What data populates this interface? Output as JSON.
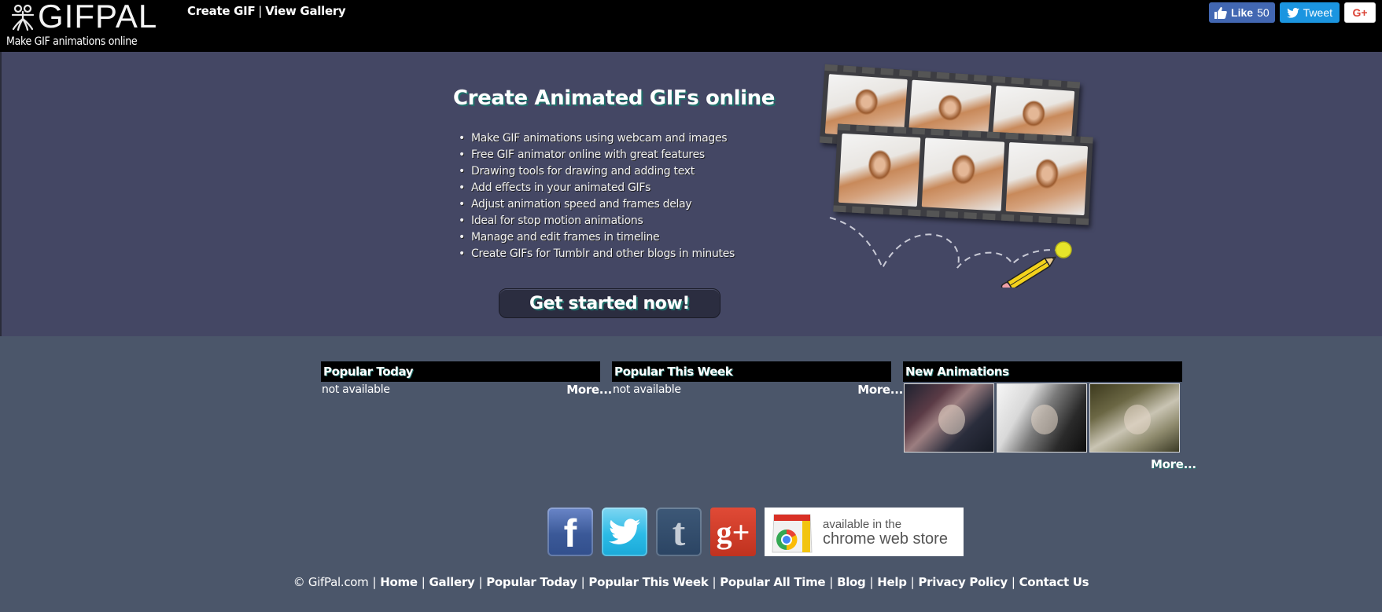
{
  "header": {
    "logo_text": "GIFPAL",
    "tagline": "Make GIF animations online",
    "nav": [
      {
        "label": "Create GIF"
      },
      {
        "label": "View Gallery"
      }
    ],
    "nav_separator": "|",
    "social": {
      "like_label": "Like",
      "like_count": "50",
      "tweet_label": "Tweet",
      "gplus_label": "G+"
    }
  },
  "hero": {
    "title": "Create Animated GIFs online",
    "features": [
      "Make GIF animations using webcam and images",
      "Free GIF animator online with great features",
      "Drawing tools for drawing and adding text",
      "Add effects in your animated GIFs",
      "Adjust animation speed and frames delay",
      "Ideal for stop motion animations",
      "Manage and edit frames in timeline",
      "Create GIFs for Tumblr and other blogs in minutes"
    ],
    "cta_label": "Get started now!"
  },
  "sections": {
    "popular_today": {
      "title": "Popular Today",
      "body": "not available",
      "more": "More..."
    },
    "popular_week": {
      "title": "Popular This Week",
      "body": "not available",
      "more": "More..."
    },
    "new_animations": {
      "title": "New Animations",
      "more": "More...",
      "thumbnail_count": 3
    }
  },
  "social_bottom": {
    "facebook_glyph": "f",
    "twitter_glyph": "🐦",
    "tumblr_glyph": "t",
    "gplus_glyph": "g+",
    "chrome_line1": "available in the",
    "chrome_line2": "chrome web store"
  },
  "footer": {
    "copyright": "© GifPal.com",
    "separator": "|",
    "links": [
      {
        "label": "Home"
      },
      {
        "label": "Gallery"
      },
      {
        "label": "Popular Today"
      },
      {
        "label": "Popular This Week"
      },
      {
        "label": "Popular All Time"
      },
      {
        "label": "Blog"
      },
      {
        "label": "Help"
      },
      {
        "label": "Privacy Policy"
      },
      {
        "label": "Contact Us"
      }
    ]
  },
  "colors": {
    "header_bg": "#000000",
    "hero_bg": "#444764",
    "content_bg": "#4b566a",
    "facebook": "#4267b2",
    "twitter": "#1b95e0",
    "gplus": "#db4437"
  }
}
